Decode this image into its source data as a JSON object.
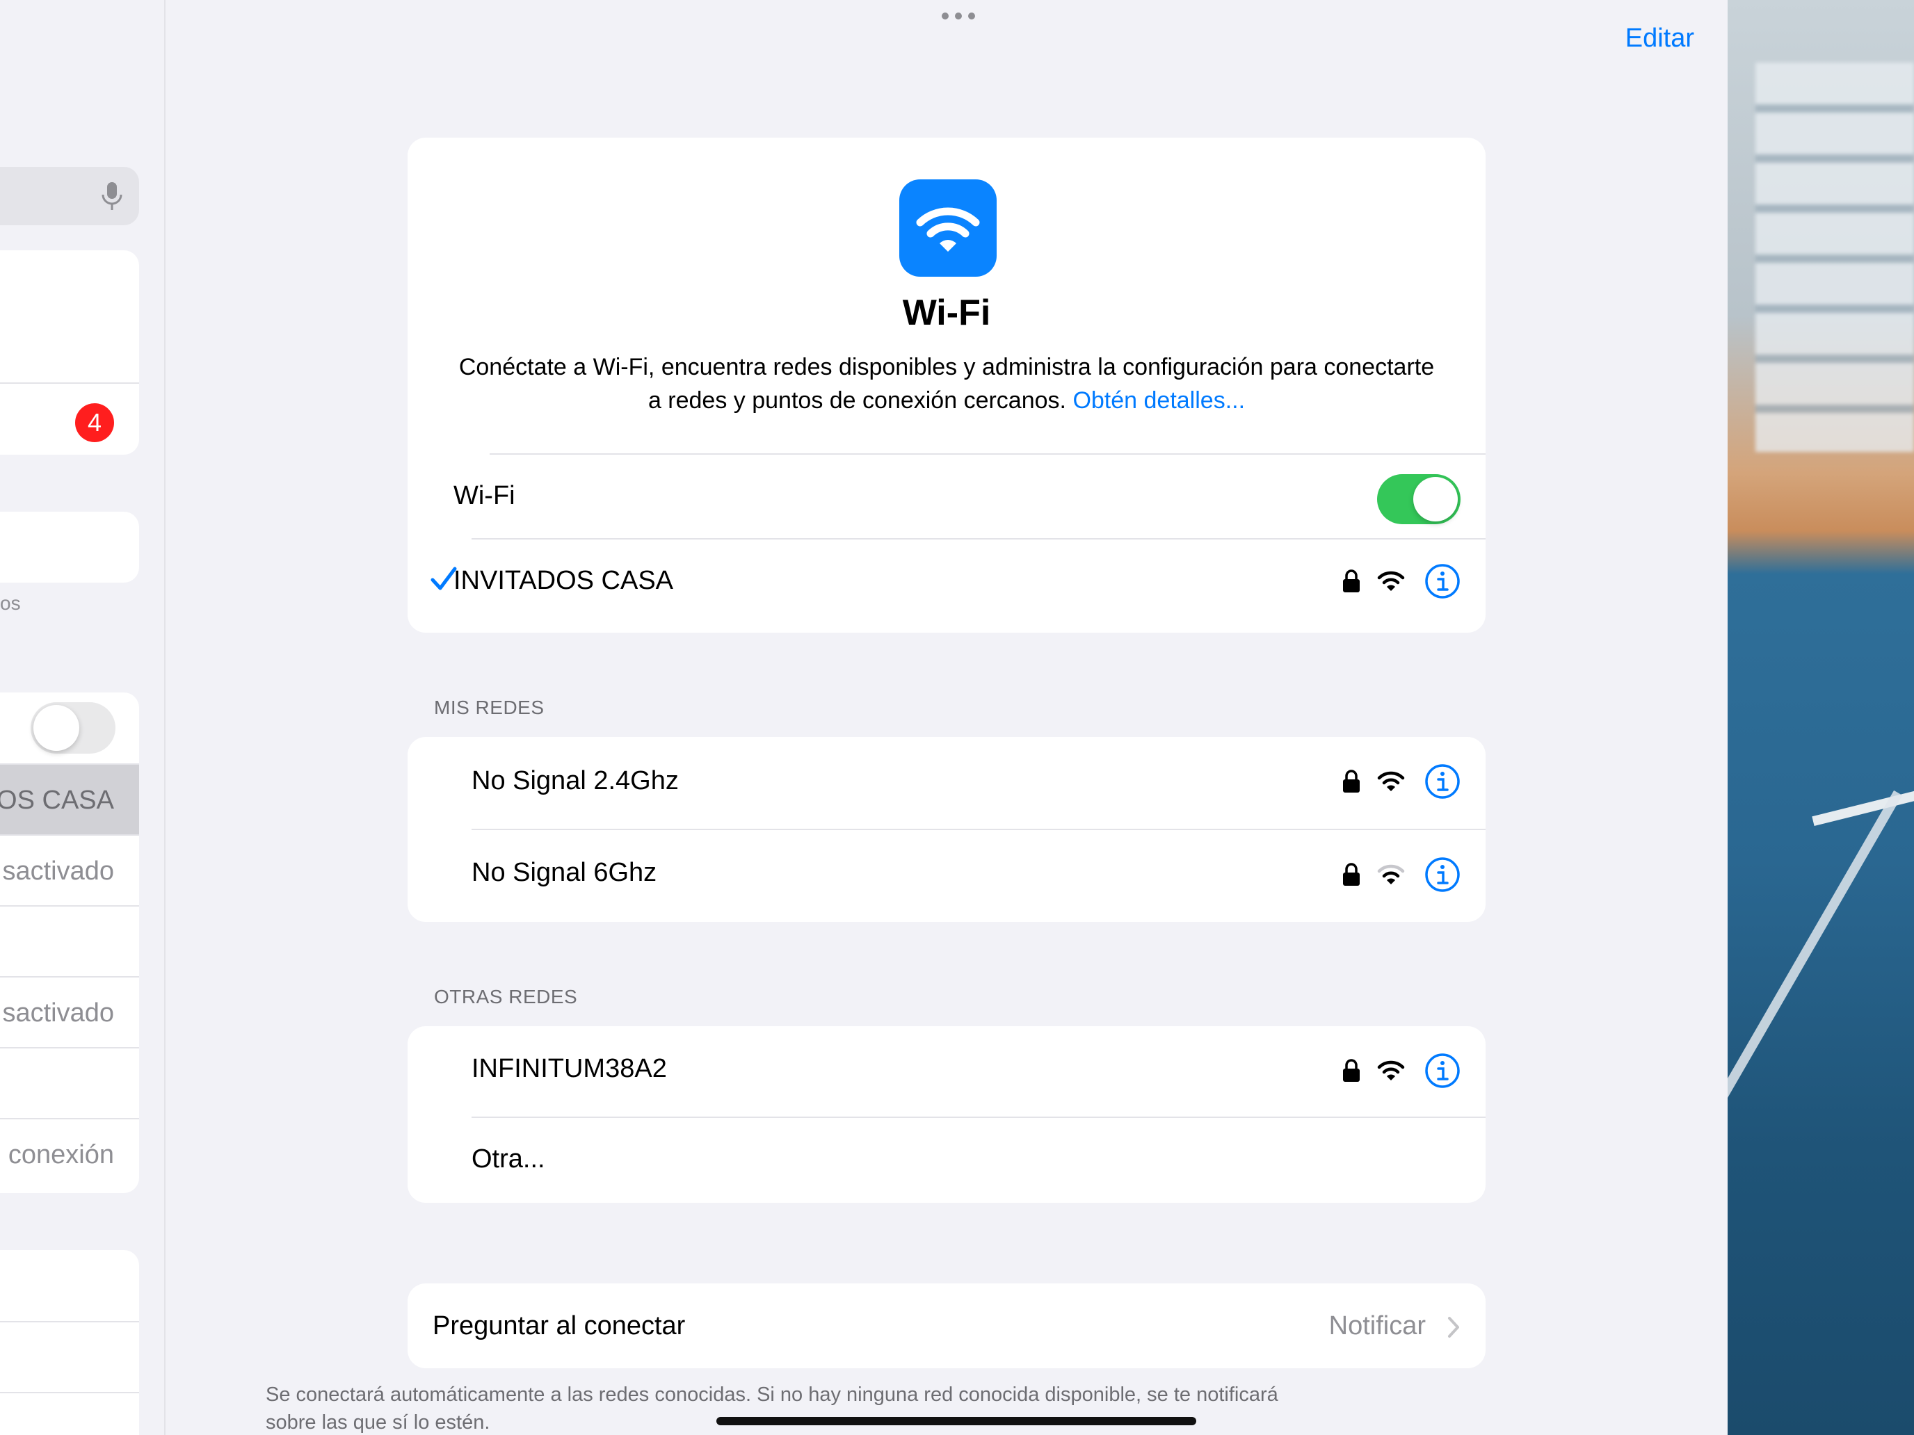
{
  "sidebar": {
    "badge_count": "4",
    "caption_fragment": "os",
    "selected_network_fragment": "OS CASA",
    "status_1": "sactivado",
    "status_2": "sactivado",
    "status_3": "conexión"
  },
  "header": {
    "edit_label": "Editar"
  },
  "hero": {
    "title": "Wi-Fi",
    "description": "Conéctate a Wi-Fi, encuentra redes disponibles y administra la configuración para conectarte a redes y puntos de conexión cercanos.",
    "link_label": "Obtén detalles..."
  },
  "wifi_toggle": {
    "label": "Wi-Fi",
    "state": "on"
  },
  "connected_network": {
    "name": "INVITADOS CASA",
    "icons": [
      "checkmark-icon",
      "lock-icon",
      "wifi-icon",
      "info-icon"
    ]
  },
  "my_networks": {
    "header": "MIS REDES",
    "items": [
      {
        "name": "No Signal 2.4Ghz",
        "signal": "full"
      },
      {
        "name": "No Signal 6Ghz",
        "signal": "weak"
      }
    ]
  },
  "other_networks": {
    "header": "OTRAS REDES",
    "items": [
      {
        "name": "INFINITUM38A2",
        "signal": "full"
      }
    ],
    "other_label": "Otra..."
  },
  "ask_to_join": {
    "label": "Preguntar al conectar",
    "value": "Notificar",
    "note": "Se conectará automáticamente a las redes conocidas. Si no hay ninguna red conocida disponible, se te notificará sobre las que sí lo estén."
  },
  "colors": {
    "accent": "#007aff",
    "toggle_on": "#34c759",
    "badge": "#ff1e1e",
    "wifi_tile": "#0a84ff"
  }
}
